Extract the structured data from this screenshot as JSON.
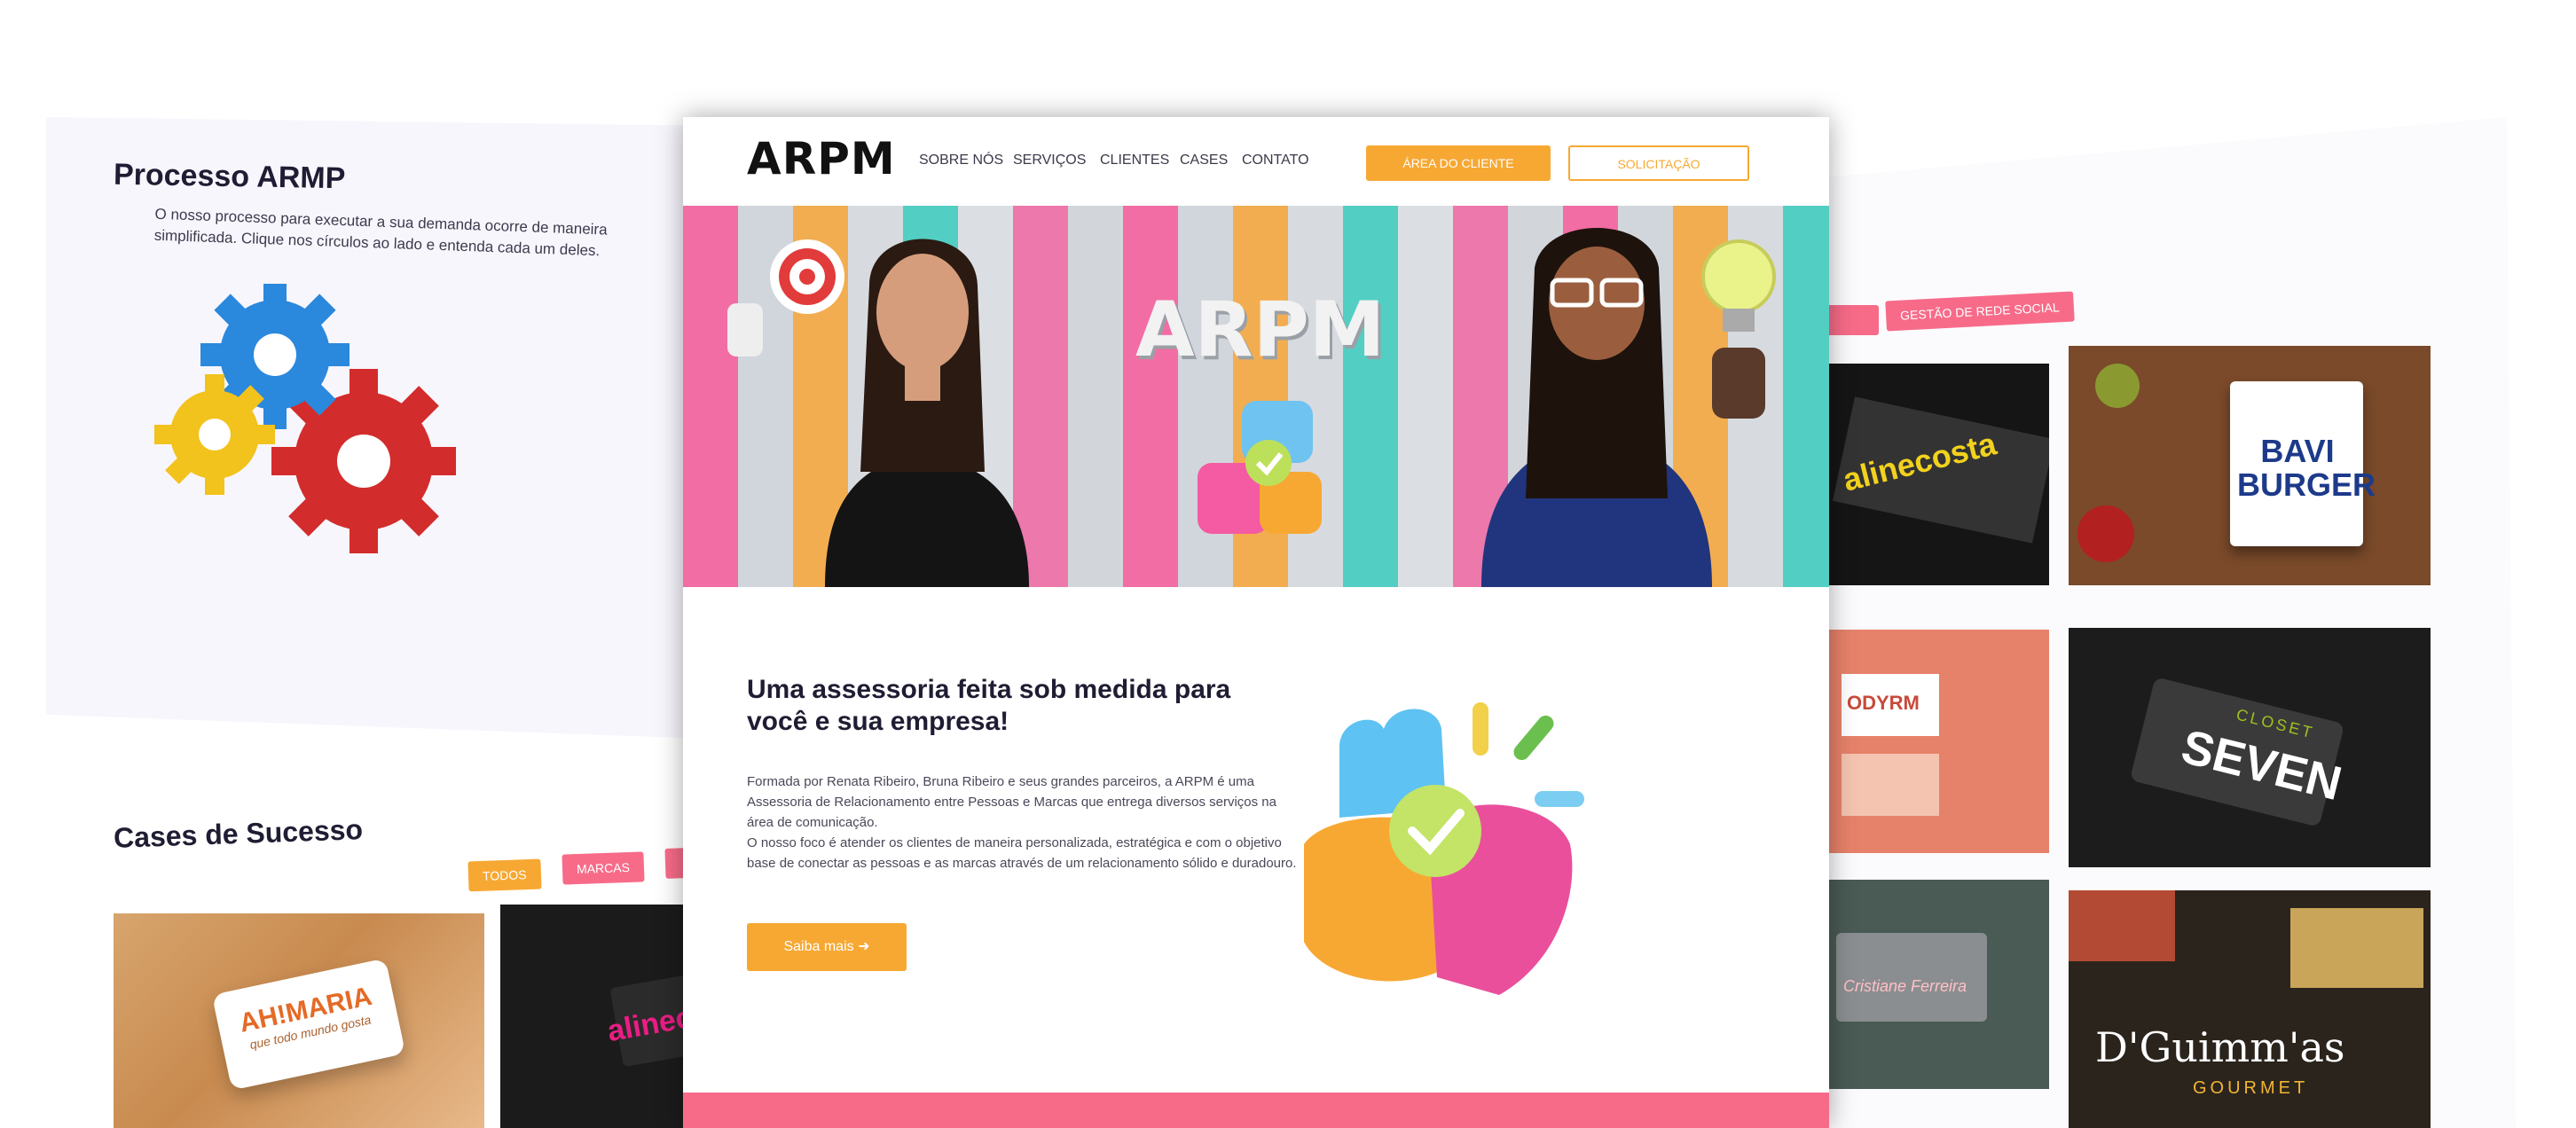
{
  "left": {
    "process_title": "Processo ARMP",
    "process_desc": "O nosso processo para executar a sua demanda ocorre de maneira simplificada. Clique nos círculos ao lado e entenda cada um deles.",
    "cases_title": "Cases de Sucesso",
    "filters": [
      "TODOS",
      "MARCAS"
    ],
    "card1": {
      "brand": "AH!MARIA",
      "tagline": "que todo mundo gosta"
    },
    "card2": {
      "brand": "alinecosta"
    }
  },
  "right": {
    "filter": "GESTÃO DE REDE SOCIAL",
    "tiles": [
      {
        "brand": "alinecosta"
      },
      {
        "brand": "BAVI BURGER"
      },
      {
        "brand": "ODYRM"
      },
      {
        "brand": "SEVEN",
        "sub": "CLOSET"
      },
      {
        "brand": "Cristiane Ferreira"
      },
      {
        "brand": "D'Guimm'as",
        "sub": "GOURMET"
      }
    ]
  },
  "center": {
    "logo": "ARPM",
    "nav": [
      "SOBRE NÓS",
      "SERVIÇOS",
      "CLIENTES",
      "CASES",
      "CONTATO"
    ],
    "btn_cliente": "ÁREA DO CLIENTE",
    "btn_solicitacao": "SOLICITAÇÃO",
    "hero_logo": "ARPM",
    "intro_title": "Uma assessoria feita sob medida para você e sua empresa!",
    "intro_text_1": "Formada por Renata Ribeiro, Bruna Ribeiro e seus grandes parceiros, a ARPM é uma Assessoria de Relacionamento entre Pessoas e Marcas que entrega diversos serviços na área de comunicação.",
    "intro_text_2": "O nosso foco é atender os clientes de maneira personalizada, estratégica e com o objetivo base de conectar as pessoas e as marcas através de um relacionamento sólido e duradouro.",
    "cta": "Saiba mais"
  },
  "colors": {
    "orange": "#f7a833",
    "pink": "#f76b89",
    "navy": "#1f1d33"
  }
}
